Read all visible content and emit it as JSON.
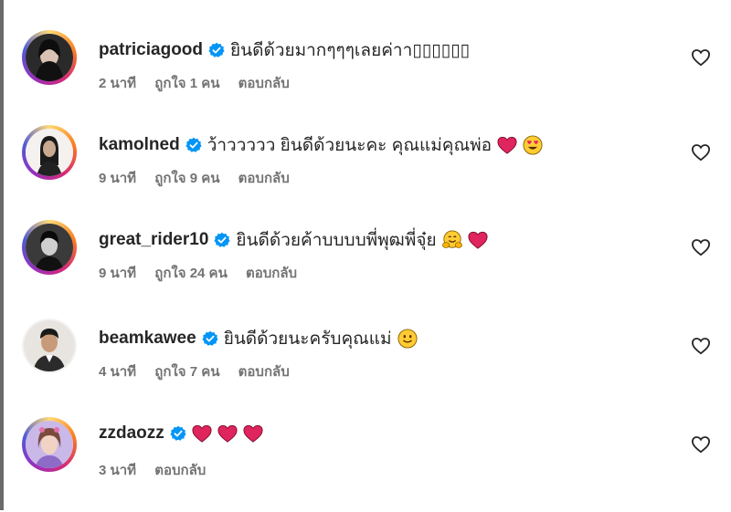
{
  "comments": [
    {
      "username": "patriciagood",
      "text": "ยินดีด้วยมากๆๆๆเลยค่าา▯▯▯▯▯▯",
      "emojis": [],
      "time": "2 นาที",
      "likes": "ถูกใจ 1 คน",
      "reply": "ตอบกลับ",
      "ring": true
    },
    {
      "username": "kamolned",
      "text": "ว้าววววว ยินดีด้วยนะคะ คุณแม่คุณพ่อ",
      "emojis": [
        "red-heart-emoji",
        "heart-eyes-emoji"
      ],
      "time": "9 นาที",
      "likes": "ถูกใจ 9 คน",
      "reply": "ตอบกลับ",
      "ring": true
    },
    {
      "username": "great_rider10",
      "text": "ยินดีด้วยค้าบบบบพี่พุฒพี่จุ๋ย",
      "emojis": [
        "hugging-face-emoji",
        "red-heart-emoji"
      ],
      "time": "9 นาที",
      "likes": "ถูกใจ 24 คน",
      "reply": "ตอบกลับ",
      "ring": true
    },
    {
      "username": "beamkawee",
      "text": "ยินดีด้วยนะครับคุณแม่",
      "emojis": [
        "slightly-smiling-face-emoji"
      ],
      "time": "4 นาที",
      "likes": "ถูกใจ 7 คน",
      "reply": "ตอบกลับ",
      "ring": false
    },
    {
      "username": "zzdaozz",
      "text": "",
      "emojis": [
        "red-heart-emoji",
        "red-heart-emoji",
        "red-heart-emoji"
      ],
      "time": "3 นาที",
      "likes": "",
      "reply": "ตอบกลับ",
      "ring": true
    }
  ],
  "icons": {
    "verified": "verified-badge-icon",
    "like": "heart-outline-icon"
  },
  "colors": {
    "verified": "#0095f6",
    "meta_text": "#737373",
    "username": "#262626",
    "heart_emoji": "#e0245e"
  }
}
